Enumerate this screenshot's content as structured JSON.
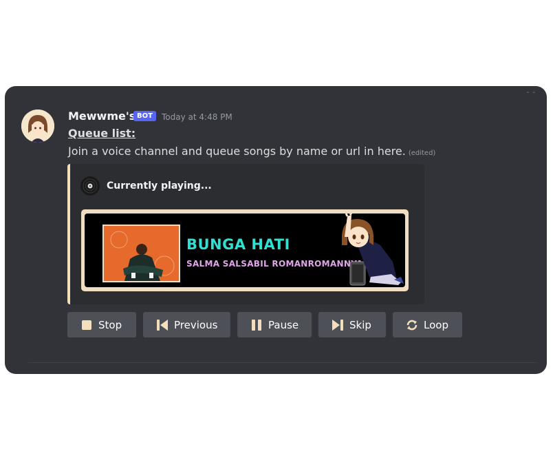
{
  "message": {
    "username": "Mewwme's",
    "badge": "BOT",
    "timestamp": "Today at 4:48 PM",
    "heading": "Queue list:",
    "text": "Join a voice channel and queue songs by name or url in here.",
    "edited_label": "(edited)"
  },
  "embed": {
    "accent_color": "#f4dfbd",
    "author": "Currently playing...",
    "author_icon": "vinyl-record-icon",
    "now_playing": {
      "title": "BUNGA HATI",
      "artist": "SALMA SALSABIL  ROMANROMANNYA"
    }
  },
  "buttons": [
    {
      "label": "Stop",
      "icon": "stop-icon"
    },
    {
      "label": "Previous",
      "icon": "previous-icon"
    },
    {
      "label": "Pause",
      "icon": "pause-icon"
    },
    {
      "label": "Skip",
      "icon": "skip-icon"
    },
    {
      "label": "Loop",
      "icon": "loop-icon"
    }
  ],
  "colors": {
    "panel_bg": "#313338",
    "bot_badge": "#5865f2",
    "button_bg": "#4e5058",
    "title_color": "#2fe0d2",
    "artist_color": "#dfa6e8"
  }
}
